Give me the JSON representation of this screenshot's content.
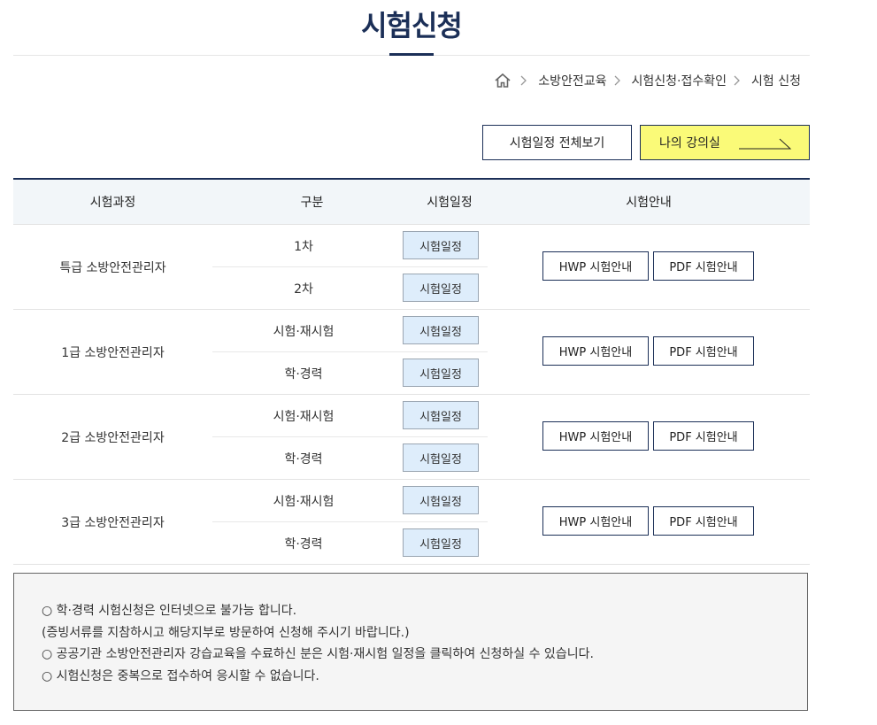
{
  "page_title": "시험신청",
  "breadcrumb": [
    "소방안전교육",
    "시험신청·접수확인",
    "시험 신청"
  ],
  "buttons": {
    "schedule_all": "시험일정 전체보기",
    "my_class": "나의 강의실"
  },
  "colors": {
    "navy": "#1b2f57",
    "my_class_bg": "#fafa78",
    "schedule_btn_bg": "#deedfb"
  },
  "table": {
    "headers": [
      "시험과정",
      "구분",
      "시험일정",
      "시험안내"
    ],
    "groups": [
      {
        "course": "특급 소방안전관리자",
        "types": [
          "1차",
          "2차"
        ],
        "schedule_label": "시험일정",
        "hwp": "HWP 시험안내",
        "pdf": "PDF 시험안내"
      },
      {
        "course": "1급 소방안전관리자",
        "types": [
          "시험·재시험",
          "학·경력"
        ],
        "schedule_label": "시험일정",
        "hwp": "HWP 시험안내",
        "pdf": "PDF 시험안내"
      },
      {
        "course": "2급 소방안전관리자",
        "types": [
          "시험·재시험",
          "학·경력"
        ],
        "schedule_label": "시험일정",
        "hwp": "HWP 시험안내",
        "pdf": "PDF 시험안내"
      },
      {
        "course": "3급 소방안전관리자",
        "types": [
          "시험·재시험",
          "학·경력"
        ],
        "schedule_label": "시험일정",
        "hwp": "HWP 시험안내",
        "pdf": "PDF 시험안내"
      }
    ]
  },
  "notice": [
    "○ 학·경력 시험신청은 인터넷으로 불가능 합니다.",
    "(증빙서류를 지참하시고 해당지부로 방문하여 신청해 주시기 바랍니다.)",
    "○ 공공기관 소방안전관리자 강습교육을 수료하신 분은 시험·재시험 일정을 클릭하여 신청하실 수 있습니다.",
    "○ 시험신청은 중복으로 접수하여 응시할 수 없습니다."
  ]
}
